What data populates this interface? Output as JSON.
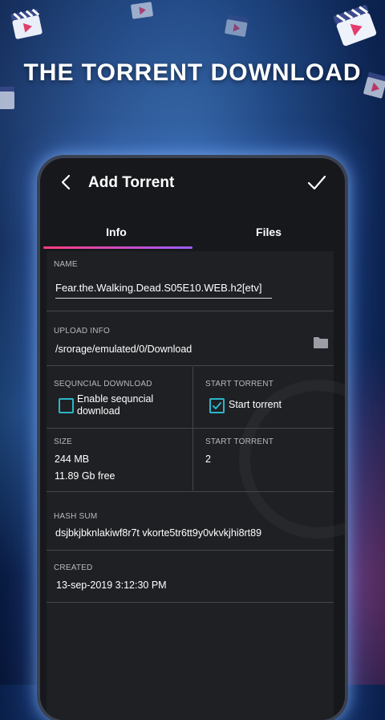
{
  "promo": {
    "headline": "THE TORRENT DOWNLOAD"
  },
  "app": {
    "title": "Add Torrent"
  },
  "tabs": [
    {
      "label": "Info",
      "active": true
    },
    {
      "label": "Files",
      "active": false
    }
  ],
  "name": {
    "label": "NAME",
    "value": "Fear.the.Walking.Dead.S05E10.WEB.h2[etv]"
  },
  "upload_info": {
    "label": "UPLOAD INFO",
    "path": "/srorage/emulated/0/Download",
    "icon": "folder-icon"
  },
  "sequential": {
    "label": "SEQUNCIAL DOWNLOAD",
    "option_line1": "Enable sequncial",
    "option_line2": "download",
    "checked": false
  },
  "start_torrent": {
    "label": "START TORRENT",
    "option": "Start torrent",
    "checked": true
  },
  "size": {
    "label": "SIZE",
    "value": "244 MB",
    "free": "11.89 Gb free"
  },
  "start_torrent_count": {
    "label": "START TORRENT",
    "value": "2"
  },
  "hash": {
    "label": "HASH SUM",
    "value": "dsjbkjbknlakiwf8r7t vkorte5tr6tt9y0vkvkjhi8rt89"
  },
  "created": {
    "label": "CREATED",
    "value": "13-sep-2019 3:12:30 PM"
  },
  "colors": {
    "accent_teal": "#2bb6c8",
    "tab_gradient_start": "#ff3b7d",
    "tab_gradient_end": "#9b5cff",
    "panel": "#1f2024",
    "background": "#17181c"
  }
}
